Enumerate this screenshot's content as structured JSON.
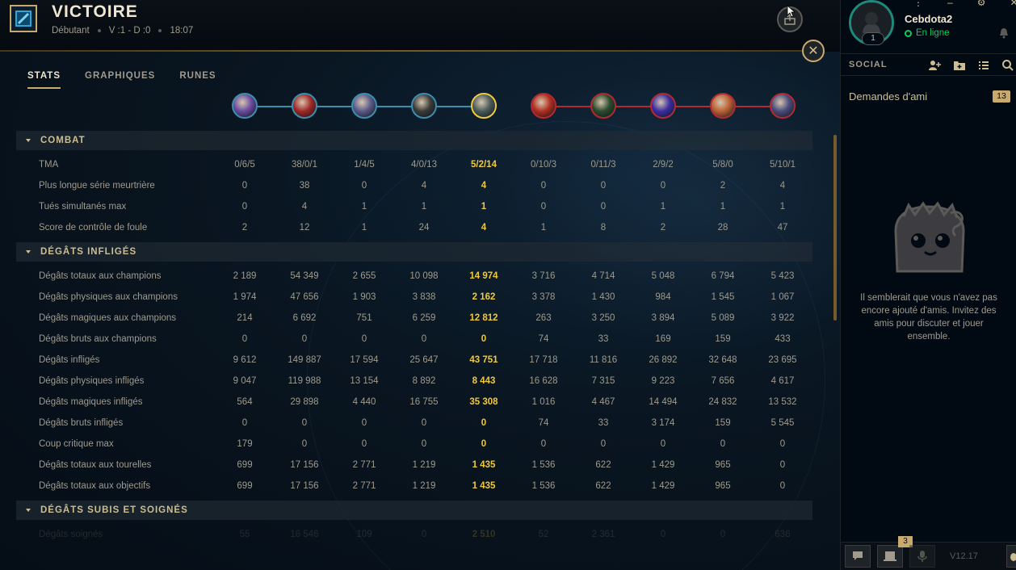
{
  "header": {
    "title": "VICTOIRE",
    "mode": "Débutant",
    "score": "V :1 - D :0",
    "duration": "18:07",
    "close_icon": "close-icon",
    "share_icon": "share-icon"
  },
  "tabs": [
    {
      "label": "STATS",
      "active": true
    },
    {
      "label": "GRAPHIQUES",
      "active": false
    },
    {
      "label": "RUNES",
      "active": false
    }
  ],
  "team_colors": {
    "blue": "#3a8fae",
    "red": "#b4282e",
    "self": "#f0c93c",
    "accent": "#c8aa6e"
  },
  "players": [
    {
      "team": "blue",
      "color": "#6a4aa0"
    },
    {
      "team": "blue",
      "color": "#a02828"
    },
    {
      "team": "blue",
      "color": "#5a5a8a"
    },
    {
      "team": "blue",
      "color": "#3a3a3a"
    },
    {
      "team": "blue",
      "color": "#4a5a5a",
      "self": true
    },
    {
      "team": "red",
      "color": "#b03020"
    },
    {
      "team": "red",
      "color": "#2a4a2a"
    },
    {
      "team": "red",
      "color": "#3a2aa0"
    },
    {
      "team": "red",
      "color": "#c06030"
    },
    {
      "team": "red",
      "color": "#4a4a7a"
    }
  ],
  "self_index": 4,
  "sections": [
    {
      "title": "COMBAT",
      "rows": [
        {
          "label": "TMA",
          "values": [
            "0/6/5",
            "38/0/1",
            "1/4/5",
            "4/0/13",
            "5/2/14",
            "0/10/3",
            "0/11/3",
            "2/9/2",
            "5/8/0",
            "5/10/1"
          ]
        },
        {
          "label": "Plus longue série meurtrière",
          "values": [
            "0",
            "38",
            "0",
            "4",
            "4",
            "0",
            "0",
            "0",
            "2",
            "4"
          ]
        },
        {
          "label": "Tués simultanés max",
          "values": [
            "0",
            "4",
            "1",
            "1",
            "1",
            "0",
            "0",
            "1",
            "1",
            "1"
          ]
        },
        {
          "label": "Score de contrôle de foule",
          "values": [
            "2",
            "12",
            "1",
            "24",
            "4",
            "1",
            "8",
            "2",
            "28",
            "47"
          ]
        }
      ]
    },
    {
      "title": "DÉGÂTS INFLIGÉS",
      "rows": [
        {
          "label": "Dégâts totaux aux champions",
          "values": [
            "2 189",
            "54 349",
            "2 655",
            "10 098",
            "14 974",
            "3 716",
            "4 714",
            "5 048",
            "6 794",
            "5 423"
          ]
        },
        {
          "label": "Dégâts physiques aux champions",
          "values": [
            "1 974",
            "47 656",
            "1 903",
            "3 838",
            "2 162",
            "3 378",
            "1 430",
            "984",
            "1 545",
            "1 067"
          ]
        },
        {
          "label": "Dégâts magiques aux champions",
          "values": [
            "214",
            "6 692",
            "751",
            "6 259",
            "12 812",
            "263",
            "3 250",
            "3 894",
            "5 089",
            "3 922"
          ]
        },
        {
          "label": "Dégâts bruts aux champions",
          "values": [
            "0",
            "0",
            "0",
            "0",
            "0",
            "74",
            "33",
            "169",
            "159",
            "433"
          ]
        },
        {
          "label": "Dégâts infligés",
          "values": [
            "9 612",
            "149 887",
            "17 594",
            "25 647",
            "43 751",
            "17 718",
            "11 816",
            "26 892",
            "32 648",
            "23 695"
          ]
        },
        {
          "label": "Dégâts physiques infligés",
          "values": [
            "9 047",
            "119 988",
            "13 154",
            "8 892",
            "8 443",
            "16 628",
            "7 315",
            "9 223",
            "7 656",
            "4 617"
          ]
        },
        {
          "label": "Dégâts magiques infligés",
          "values": [
            "564",
            "29 898",
            "4 440",
            "16 755",
            "35 308",
            "1 016",
            "4 467",
            "14 494",
            "24 832",
            "13 532"
          ]
        },
        {
          "label": "Dégâts bruts infligés",
          "values": [
            "0",
            "0",
            "0",
            "0",
            "0",
            "74",
            "33",
            "3 174",
            "159",
            "5 545"
          ]
        },
        {
          "label": "Coup critique max",
          "values": [
            "179",
            "0",
            "0",
            "0",
            "0",
            "0",
            "0",
            "0",
            "0",
            "0"
          ]
        },
        {
          "label": "Dégâts totaux aux tourelles",
          "values": [
            "699",
            "17 156",
            "2 771",
            "1 219",
            "1 435",
            "1 536",
            "622",
            "1 429",
            "965",
            "0"
          ]
        },
        {
          "label": "Dégâts totaux aux objectifs",
          "values": [
            "699",
            "17 156",
            "2 771",
            "1 219",
            "1 435",
            "1 536",
            "622",
            "1 429",
            "965",
            "0"
          ]
        }
      ]
    },
    {
      "title": "DÉGÂTS SUBIS ET SOIGNÉS",
      "rows": [
        {
          "label": "Dégâts soignés",
          "values": [
            "55",
            "16 546",
            "109",
            "0",
            "2 510",
            "52",
            "2 361",
            "0",
            "0",
            "636"
          ],
          "faded": true
        }
      ]
    }
  ],
  "social": {
    "summoner": "Cebdota2",
    "status": "En ligne",
    "level": "1",
    "title": "SOCIAL",
    "friend_requests_label": "Demandes d'ami",
    "friend_requests_count": "13",
    "empty_message": "Il semblerait que vous n'avez pas encore ajouté d'amis. Invitez des amis pour discuter et jouer ensemble.",
    "notification_count": "3",
    "version": "V12.17",
    "status_color": "#0acb5a"
  }
}
